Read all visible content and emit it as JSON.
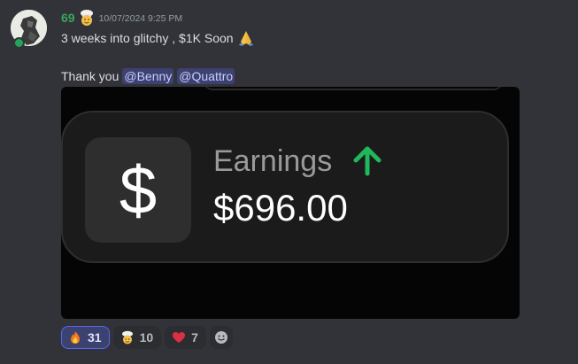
{
  "message": {
    "author": "69",
    "timestamp": "10/07/2024 9:25 PM",
    "line1": "3 weeks into glitchy , $1K Soon",
    "line2_prefix": "Thank you",
    "mentions": [
      "@Benny",
      "@Quattro"
    ]
  },
  "embed": {
    "label": "Earnings",
    "value": "$696.00",
    "dollar_glyph": "$",
    "arrow_icon": "arrow-up-icon",
    "arrow_color": "#1fb85a"
  },
  "reactions": [
    {
      "emoji": "fire-emoji",
      "count": "31",
      "active": true
    },
    {
      "emoji": "chef-face-emoji",
      "count": "10",
      "active": false
    },
    {
      "emoji": "red-heart-emoji",
      "count": "7",
      "active": false
    }
  ],
  "colors": {
    "background": "#313338",
    "username": "#3ba55c",
    "mention_bg": "#3c4270",
    "mention_text": "#c9cdfb"
  }
}
